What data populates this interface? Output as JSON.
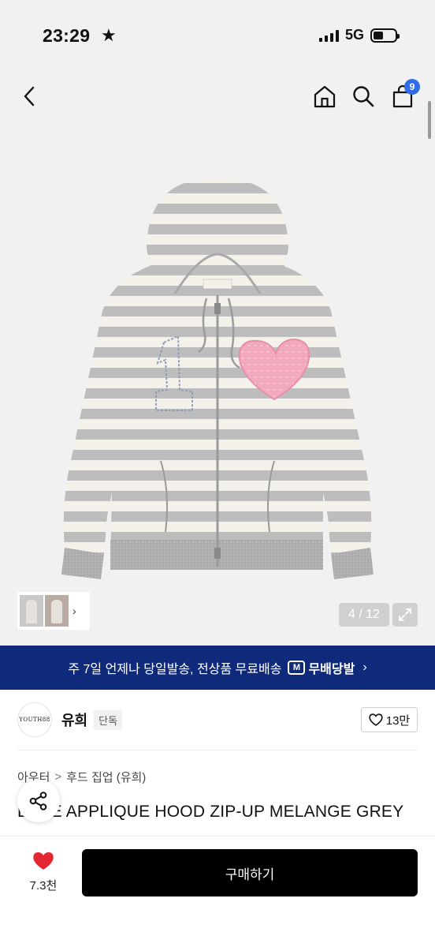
{
  "status_bar": {
    "time": "23:29",
    "time_icon": "star-icon",
    "network": "5G",
    "battery_level": 0.45
  },
  "nav": {
    "back_icon": "chevron-left-icon",
    "home_icon": "home-icon",
    "search_icon": "search-icon",
    "cart_icon": "shopping-bag-icon",
    "cart_count": "9"
  },
  "gallery": {
    "page_indicator": "4 / 12",
    "expand_icon": "expand-icon",
    "thumb_arrow": "›"
  },
  "promo": {
    "text": "주 7일 언제나 당일발송, 전상품 무료배송",
    "badge_logo": "M",
    "badge_label": "무배당발",
    "chevron": "›",
    "color": "#0f2a7a"
  },
  "brand": {
    "logo_text": "YOUTH88",
    "name": "유희",
    "tag": "단독",
    "like_count": "13만"
  },
  "breadcrumb": {
    "category": "아우터",
    "separator": ">",
    "subcategory": "후드 집업 (유희)"
  },
  "product": {
    "title": "LOVE APPLIQUE HOOD ZIP-UP MELANGE GREY"
  },
  "bottom_bar": {
    "wish_count": "7.3천",
    "buy_label": "구매하기",
    "heart_color": "#e3262f"
  }
}
